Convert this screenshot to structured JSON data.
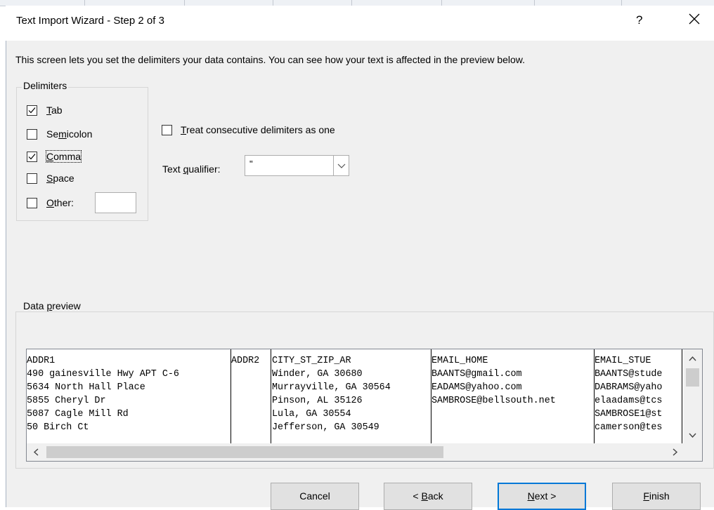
{
  "dialog": {
    "title": "Text Import Wizard - Step 2 of 3",
    "help_glyph": "?",
    "instructions": "This screen lets you set the delimiters your data contains.  You can see how your text is affected in the preview below."
  },
  "delimiters": {
    "legend": "Delimiters",
    "tab": {
      "pre": "",
      "key": "T",
      "post": "ab",
      "checked": true
    },
    "semicolon": {
      "pre": "Se",
      "key": "m",
      "post": "icolon",
      "checked": false
    },
    "comma": {
      "pre": "",
      "key": "C",
      "post": "omma",
      "checked": true
    },
    "space": {
      "pre": "",
      "key": "S",
      "post": "pace",
      "checked": false
    },
    "other": {
      "pre": "",
      "key": "O",
      "post": "ther:",
      "checked": false,
      "value": ""
    }
  },
  "options": {
    "consecutive": {
      "pre": "",
      "key": "T",
      "post": "reat consecutive delimiters as one",
      "checked": false
    },
    "qualifier": {
      "pre": "Text ",
      "key": "q",
      "post": "ualifier:",
      "value": "\""
    }
  },
  "preview": {
    "legend_pre": "Data ",
    "legend_key": "p",
    "legend_post": "review",
    "columns": [
      {
        "header": "ADDR1",
        "rows": [
          "490 gainesville Hwy APT C-6",
          "5634 North Hall Place",
          "5855 Cheryl Dr",
          "5087 Cagle Mill Rd",
          "50 Birch Ct"
        ]
      },
      {
        "header": "ADDR2",
        "rows": [
          "",
          "",
          "",
          "",
          ""
        ]
      },
      {
        "header": "CITY_ST_ZIP_AR",
        "rows": [
          "Winder, GA 30680",
          "Murrayville, GA 30564",
          "Pinson, AL 35126",
          "Lula, GA 30554",
          "Jefferson, GA 30549"
        ]
      },
      {
        "header": "EMAIL_HOME",
        "rows": [
          "BAANTS@gmail.com",
          "",
          "EADAMS@yahoo.com",
          "SAMBROSE@bellsouth.net",
          ""
        ]
      },
      {
        "header": "EMAIL_STUE",
        "rows": [
          "BAANTS@stude",
          "DABRAMS@yaho",
          "elaadams@tcs",
          "SAMBROSE1@st",
          "camerson@tes"
        ]
      }
    ]
  },
  "buttons": {
    "cancel": {
      "pre": "Cancel",
      "key": "",
      "post": ""
    },
    "back": {
      "pre": "< ",
      "key": "B",
      "post": "ack"
    },
    "next": {
      "pre": "",
      "key": "N",
      "post": "ext >"
    },
    "finish": {
      "pre": "",
      "key": "F",
      "post": "inish"
    }
  },
  "icons": {
    "close": "close-icon",
    "check": "checkmark-icon",
    "dropdown": "chevron-down-icon",
    "scroll_up": "chevron-up-icon",
    "scroll_down": "chevron-down-icon",
    "scroll_left": "chevron-left-icon",
    "scroll_right": "chevron-right-icon"
  },
  "colors": {
    "dialog_bg": "#f0f0f0",
    "default_button_border": "#0078d7",
    "button_bg": "#e1e1e1"
  }
}
